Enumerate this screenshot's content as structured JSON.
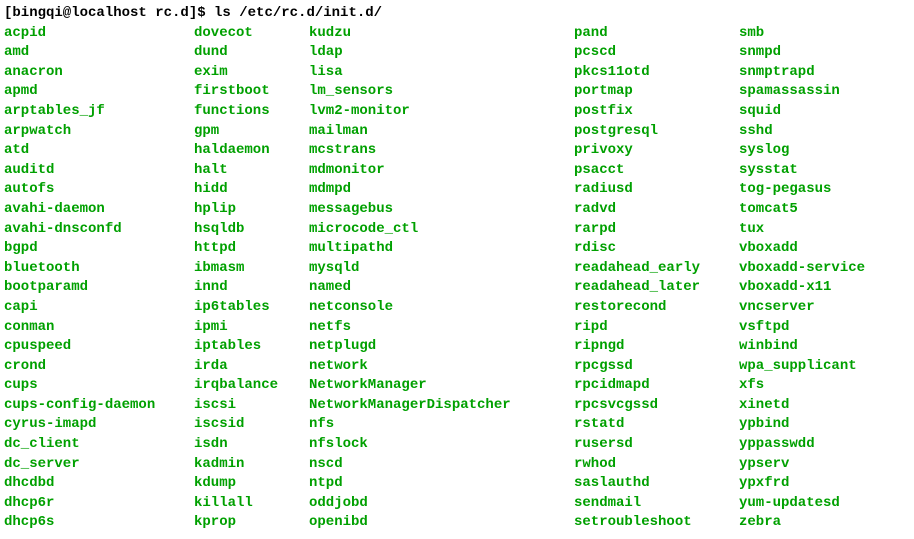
{
  "prompt": "[bingqi@localhost rc.d]$ ls /etc/rc.d/init.d/",
  "columns": {
    "col1": [
      "acpid",
      "amd",
      "anacron",
      "apmd",
      "arptables_jf",
      "arpwatch",
      "atd",
      "auditd",
      "autofs",
      "avahi-daemon",
      "avahi-dnsconfd",
      "bgpd",
      "bluetooth",
      "bootparamd",
      "capi",
      "conman",
      "cpuspeed",
      "crond",
      "cups",
      "cups-config-daemon",
      "cyrus-imapd",
      "dc_client",
      "dc_server",
      "dhcdbd",
      "dhcp6r",
      "dhcp6s"
    ],
    "col2": [
      "dovecot",
      "dund",
      "exim",
      "firstboot",
      "functions",
      "gpm",
      "haldaemon",
      "halt",
      "hidd",
      "hplip",
      "hsqldb",
      "httpd",
      "ibmasm",
      "innd",
      "ip6tables",
      "ipmi",
      "iptables",
      "irda",
      "irqbalance",
      "iscsi",
      "iscsid",
      "isdn",
      "kadmin",
      "kdump",
      "killall",
      "kprop"
    ],
    "col3": [
      "kudzu",
      "ldap",
      "lisa",
      "lm_sensors",
      "lvm2-monitor",
      "mailman",
      "mcstrans",
      "mdmonitor",
      "mdmpd",
      "messagebus",
      "microcode_ctl",
      "multipathd",
      "mysqld",
      "named",
      "netconsole",
      "netfs",
      "netplugd",
      "network",
      "NetworkManager",
      "NetworkManagerDispatcher",
      "nfs",
      "nfslock",
      "nscd",
      "ntpd",
      "oddjobd",
      "openibd"
    ],
    "col4": [
      "pand",
      "pcscd",
      "pkcs11otd",
      "portmap",
      "postfix",
      "postgresql",
      "privoxy",
      "psacct",
      "radiusd",
      "radvd",
      "rarpd",
      "rdisc",
      "readahead_early",
      "readahead_later",
      "restorecond",
      "ripd",
      "ripngd",
      "rpcgssd",
      "rpcidmapd",
      "rpcsvcgssd",
      "rstatd",
      "rusersd",
      "rwhod",
      "saslauthd",
      "sendmail",
      "setroubleshoot"
    ],
    "col5": [
      "smb",
      "snmpd",
      "snmptrapd",
      "spamassassin",
      "squid",
      "sshd",
      "syslog",
      "sysstat",
      "tog-pegasus",
      "tomcat5",
      "tux",
      "vboxadd",
      "vboxadd-service",
      "vboxadd-x11",
      "vncserver",
      "vsftpd",
      "winbind",
      "wpa_supplicant",
      "xfs",
      "xinetd",
      "ypbind",
      "yppasswdd",
      "ypserv",
      "ypxfrd",
      "yum-updatesd",
      "zebra"
    ]
  }
}
